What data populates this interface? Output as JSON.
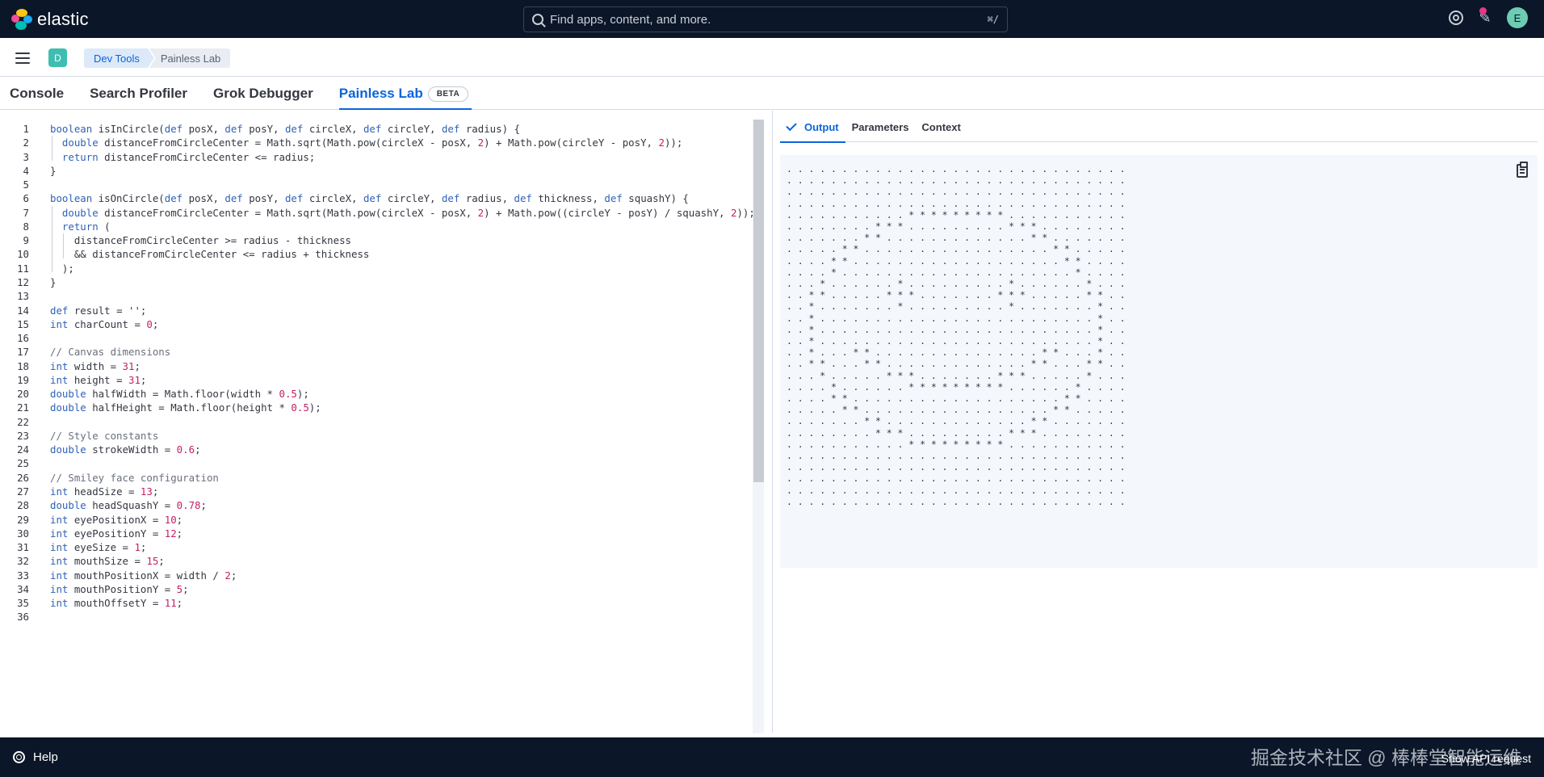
{
  "header": {
    "brand": "elastic",
    "search_placeholder": "Find apps, content, and more.",
    "search_shortcut": "⌘/",
    "avatar_initial": "E",
    "icons": [
      "help-icon",
      "newsfeed-icon"
    ]
  },
  "navbar": {
    "space_initial": "D",
    "breadcrumbs": [
      "Dev Tools",
      "Painless Lab"
    ]
  },
  "tabs": [
    {
      "label": "Console"
    },
    {
      "label": "Search Profiler"
    },
    {
      "label": "Grok Debugger"
    },
    {
      "label": "Painless Lab",
      "badge": "BETA",
      "active": true
    }
  ],
  "editor": {
    "lines": [
      "boolean isInCircle(def posX, def posY, def circleX, def circleY, def radius) {",
      "  double distanceFromCircleCenter = Math.sqrt(Math.pow(circleX - posX, 2) + Math.pow(circleY - posY, 2));",
      "  return distanceFromCircleCenter <= radius;",
      "}",
      "",
      "boolean isOnCircle(def posX, def posY, def circleX, def circleY, def radius, def thickness, def squashY) {",
      "  double distanceFromCircleCenter = Math.sqrt(Math.pow(circleX - posX, 2) + Math.pow((circleY - posY) / squashY, 2));",
      "  return (",
      "    distanceFromCircleCenter >= radius - thickness",
      "    && distanceFromCircleCenter <= radius + thickness",
      "  );",
      "}",
      "",
      "def result = '';",
      "int charCount = 0;",
      "",
      "// Canvas dimensions",
      "int width = 31;",
      "int height = 31;",
      "double halfWidth = Math.floor(width * 0.5);",
      "double halfHeight = Math.floor(height * 0.5);",
      "",
      "// Style constants",
      "double strokeWidth = 0.6;",
      "",
      "// Smiley face configuration",
      "int headSize = 13;",
      "double headSquashY = 0.78;",
      "int eyePositionX = 10;",
      "int eyePositionY = 12;",
      "int eyeSize = 1;",
      "int mouthSize = 15;",
      "int mouthPositionX = width / 2;",
      "int mouthPositionY = 5;",
      "int mouthOffsetY = 11;",
      ""
    ]
  },
  "output": {
    "tabs": [
      {
        "label": "Output",
        "active": true
      },
      {
        "label": "Parameters"
      },
      {
        "label": "Context"
      }
    ],
    "lines": [
      ". . . . . . . . . . . . . . . . . . . . . . . . . . . . . . .",
      ". . . . . . . . . . . . . . . . . . . . . . . . . . . . . . .",
      ". . . . . . . . . . . . . . . . . . . . . . . . . . . . . . .",
      ". . . . . . . . . . . . . . . . . . . . . . . . . . . . . . .",
      ". . . . . . . . . . . * * * * * * * * * . . . . . . . . . . .",
      ". . . . . . . . * * * . . . . . . . . . * * * . . . . . . . .",
      ". . . . . . . * * . . . . . . . . . . . . . * * . . . . . . .",
      ". . . . . * * . . . . . . . . . . . . . . . . . * * . . . . .",
      ". . . . * * . . . . . . . . . . . . . . . . . . . * * . . . .",
      ". . . . * . . . . . . . . . . . . . . . . . . . . . * . . . .",
      ". . . * . . . . . . * . . . . . . . . . * . . . . . . * . . .",
      ". . * * . . . . . * * * . . . . . . . * * * . . . . . * * . .",
      ". . * . . . . . . . * . . . . . . . . . * . . . . . . . * . .",
      ". . * . . . . . . . . . . . . . . . . . . . . . . . . . * . .",
      ". . * . . . . . . . . . . . . . . . . . . . . . . . . . * . .",
      ". . * . . . . . . . . . . . . . . . . . . . . . . . . . * . .",
      ". . * . . . * * . . . . . . . . . . . . . . . * * . . . * . .",
      ". . * * . . . * * . . . . . . . . . . . . . * * . . . * * . .",
      ". . . * . . . . . * * * . . . . . . . * * * . . . . . * . . .",
      ". . . . * . . . . . . * * * * * * * * * . . . . . . * . . . .",
      ". . . . * * . . . . . . . . . . . . . . . . . . . * * . . . .",
      ". . . . . * * . . . . . . . . . . . . . . . . . * * . . . . .",
      ". . . . . . . * * . . . . . . . . . . . . . * * . . . . . . .",
      ". . . . . . . . * * * . . . . . . . . . * * * . . . . . . . .",
      ". . . . . . . . . . . * * * * * * * * * . . . . . . . . . . .",
      ". . . . . . . . . . . . . . . . . . . . . . . . . . . . . . .",
      ". . . . . . . . . . . . . . . . . . . . . . . . . . . . . . .",
      ". . . . . . . . . . . . . . . . . . . . . . . . . . . . . . .",
      ". . . . . . . . . . . . . . . . . . . . . . . . . . . . . . .",
      ". . . . . . . . . . . . . . . . . . . . . . . . . . . . . . ."
    ]
  },
  "footer": {
    "help_label": "Help",
    "api_label": "Show API request",
    "watermark": "掘金技术社区 @ 棒棒堂智能运维"
  },
  "colors": {
    "header_bg": "#0b1628",
    "accent": "#0b64dd",
    "keyword": "#2f62b8",
    "number": "#c61e65",
    "comment": "#69707d",
    "space_badge": "#3ebeb0",
    "avatar": "#6dccb1"
  }
}
